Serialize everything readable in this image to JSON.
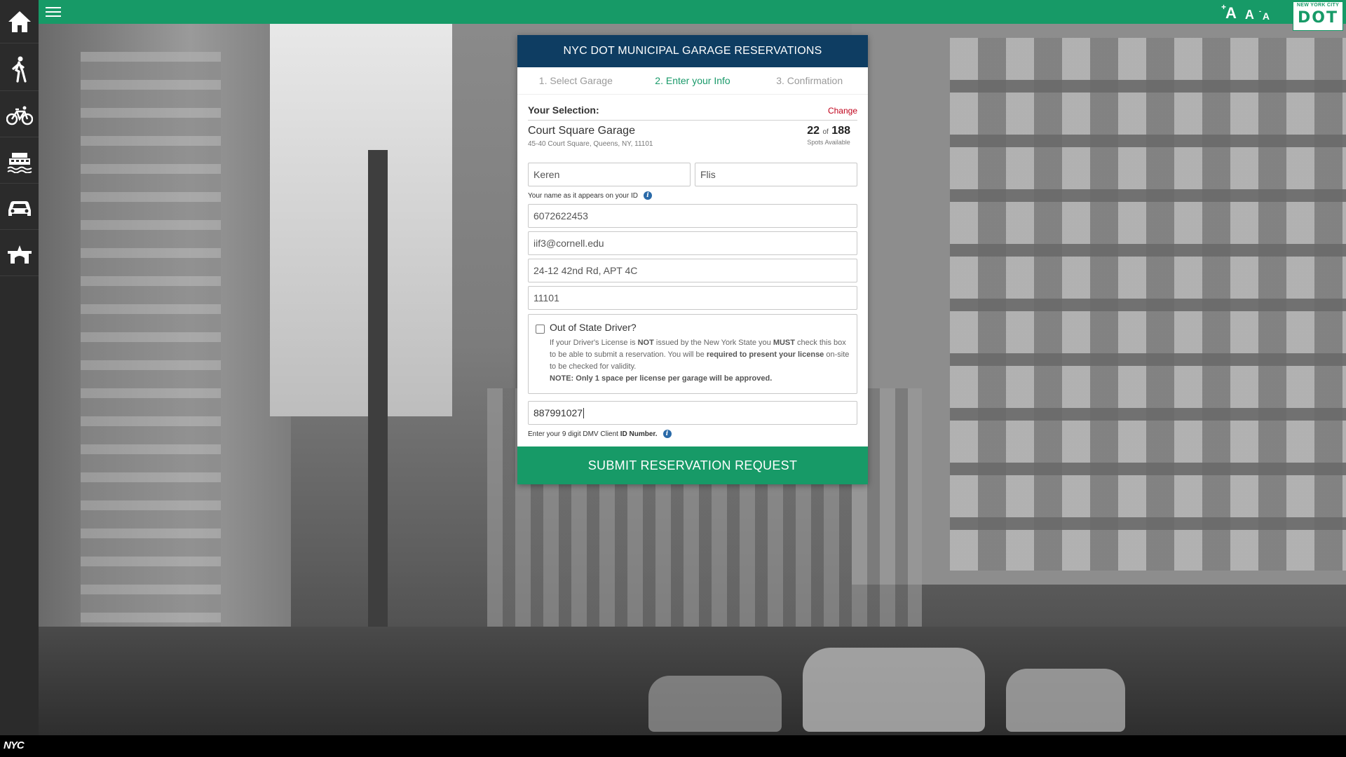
{
  "topbar": {
    "font_controls": {
      "increase": "A",
      "normal": "A",
      "decrease": "A",
      "plus": "+",
      "minus": "-"
    },
    "logo": {
      "caption": "NEW YORK CITY",
      "word": "DOT"
    }
  },
  "sidebar": {
    "items": [
      {
        "icon": "home-icon"
      },
      {
        "icon": "pedestrian-icon"
      },
      {
        "icon": "bicycle-icon"
      },
      {
        "icon": "ferry-icon"
      },
      {
        "icon": "car-icon"
      },
      {
        "icon": "bridge-icon"
      }
    ]
  },
  "footer": {
    "logo": "NYC"
  },
  "form": {
    "header": "NYC DOT MUNICIPAL GARAGE RESERVATIONS",
    "steps": [
      "1. Select Garage",
      "2. Enter your Info",
      "3. Confirmation"
    ],
    "active_step": 2,
    "selection_label": "Your Selection:",
    "change_label": "Change",
    "garage": {
      "name": "Court Square Garage",
      "address": "45-40 Court Square, Queens, NY, 11101",
      "spots_available": "22",
      "of": "of",
      "spots_total": "188",
      "spots_label": "Spots Available"
    },
    "first_name": "Keren",
    "last_name": "Flis",
    "name_hint": "Your name as it appears on your ID",
    "phone": "6072622453",
    "email": "iif3@cornell.edu",
    "address": "24-12 42nd Rd, APT 4C",
    "zip": "11101",
    "out_of_state": {
      "label": "Out of State Driver?",
      "checked": false,
      "t1": "If your Driver's License is ",
      "b1": "NOT",
      "t2": " issued by the New York State you ",
      "b2": "MUST",
      "t3": " check this box to be able to submit a reservation. You will be ",
      "b3": "required to present your license",
      "t4": " on-site to be checked for validity.",
      "note": "NOTE: Only 1 space per license per garage will be approved."
    },
    "dmv_id": "887991027",
    "dmv_hint_text": "Enter your 9 digit DMV Client ",
    "dmv_hint_bold": "ID Number.",
    "submit_label": "SUBMIT RESERVATION REQUEST"
  },
  "colors": {
    "topbar": "#179a67",
    "header": "#0e3d62",
    "sidebar": "#2b2b2b",
    "active_step": "#1a9a6a",
    "change_link": "#c0001a"
  }
}
